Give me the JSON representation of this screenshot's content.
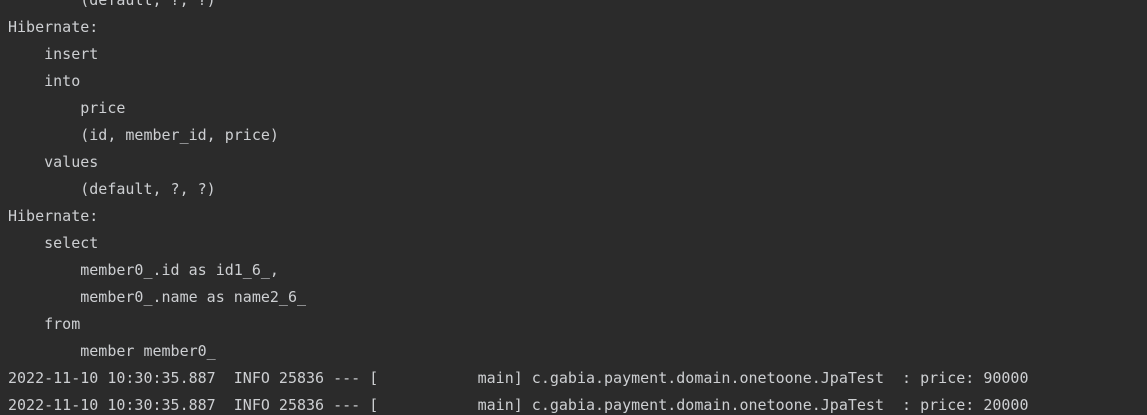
{
  "console": {
    "lines": [
      "        (default, ?, ?)",
      "Hibernate: ",
      "    insert ",
      "    into",
      "        price",
      "        (id, member_id, price) ",
      "    values",
      "        (default, ?, ?)",
      "Hibernate: ",
      "    select",
      "        member0_.id as id1_6_,",
      "        member0_.name as name2_6_ ",
      "    from",
      "        member member0_",
      "2022-11-10 10:30:35.887  INFO 25836 --- [           main] c.gabia.payment.domain.onetoone.JpaTest  : price: 90000",
      "2022-11-10 10:30:35.887  INFO 25836 --- [           main] c.gabia.payment.domain.onetoone.JpaTest  : price: 20000"
    ]
  }
}
